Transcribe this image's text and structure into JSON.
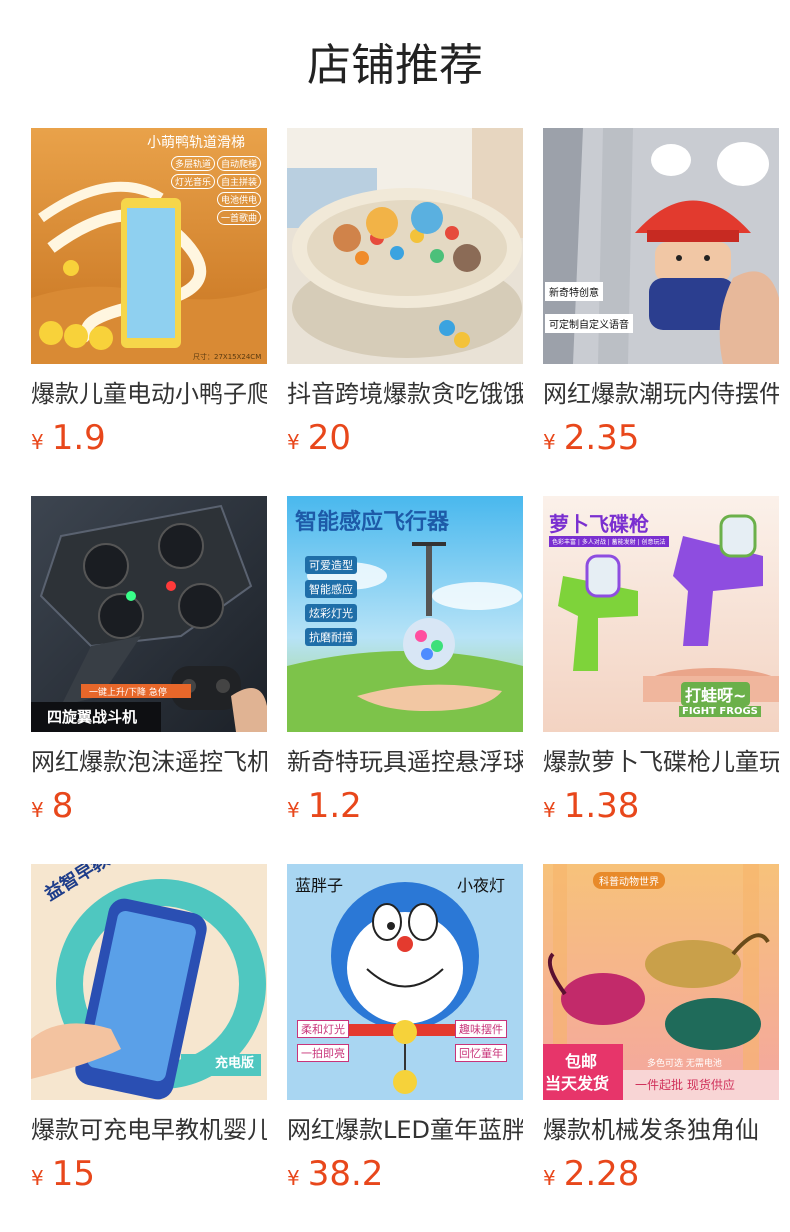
{
  "title": "店铺推荐",
  "currency": "¥",
  "products": [
    {
      "name": "爆款儿童电动小鸭子爬楼梯",
      "price": "1.9",
      "image": "duck-track-slide-toy",
      "overlay": [
        "小萌鸭轨道滑梯",
        "多层轨道",
        "自动爬梯",
        "灯光音乐",
        "自主拼装",
        "电池供电",
        "一首歌曲",
        "尺寸：27X15X24CM"
      ]
    },
    {
      "name": "抖音跨境爆款贪吃饿饿鼠",
      "price": "20",
      "image": "hungry-hamster-game",
      "overlay": []
    },
    {
      "name": "网红爆款潮玩内侍摆件",
      "price": "2.35",
      "image": "eunuch-figure-toy",
      "overlay": [
        "新奇特创意",
        "可定制自定义语音"
      ]
    },
    {
      "name": "网红爆款泡沫遥控飞机",
      "price": "8",
      "image": "foam-rc-fighter",
      "overlay": [
        "一键上升/下降 急停",
        "四旋翼战斗机"
      ]
    },
    {
      "name": "新奇特玩具遥控悬浮球",
      "price": "1.2",
      "image": "flying-ball-toy",
      "overlay": [
        "智能感应飞行器",
        "可爱造型",
        "智能感应",
        "炫彩灯光",
        "抗磨耐撞"
      ]
    },
    {
      "name": "爆款萝卜飞碟枪儿童玩具",
      "price": "1.38",
      "image": "ufo-launcher-gun",
      "overlay": [
        "萝卜飞碟枪",
        "色彩丰富 | 多人对战 | 蓄能发射 | 创意玩法",
        "打蛙呀~",
        "FIGHT FROGS"
      ]
    },
    {
      "name": "爆款可充电早教机婴儿",
      "price": "15",
      "image": "learning-phone-toy",
      "overlay": [
        "益智早教手机",
        "充电版"
      ]
    },
    {
      "name": "网红爆款LED童年蓝胖子",
      "price": "38.2",
      "image": "blue-cat-night-light",
      "overlay": [
        "蓝胖子",
        "小夜灯",
        "柔和灯光",
        "趣味摆件",
        "一拍即亮",
        "回忆童年"
      ]
    },
    {
      "name": "爆款机械发条独角仙",
      "price": "2.28",
      "image": "wind-up-beetle-toy",
      "overlay": [
        "科普动物世界",
        "包邮",
        "当天发货",
        "多色可选 无需电池",
        "一件起批 现货供应"
      ]
    }
  ]
}
